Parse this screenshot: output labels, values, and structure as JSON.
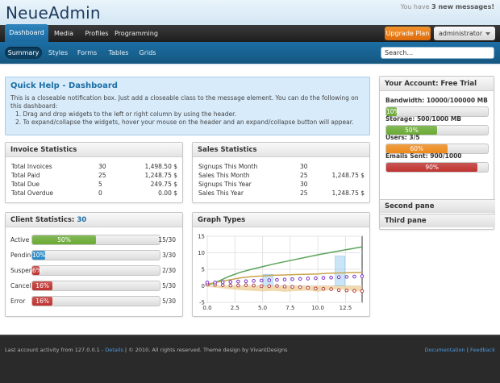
{
  "app": {
    "brand": "NeueAdmin",
    "messages_prefix": "You have",
    "messages_count": "3 new messages!"
  },
  "nav": {
    "tabs": [
      {
        "label": "Dashboard",
        "active": true
      },
      {
        "label": "Media",
        "active": false
      },
      {
        "label": "Profiles",
        "active": false
      },
      {
        "label": "Programming",
        "active": false
      }
    ],
    "upgrade_label": "Upgrade Plan",
    "user_label": "administrator"
  },
  "subnav": {
    "tabs": [
      {
        "label": "Summary",
        "active": true
      },
      {
        "label": "Styles",
        "active": false
      },
      {
        "label": "Forms",
        "active": false
      },
      {
        "label": "Tables",
        "active": false
      },
      {
        "label": "Grids",
        "active": false
      }
    ],
    "search_placeholder": "Search..."
  },
  "help": {
    "title": "Quick Help - Dashboard",
    "intro": "This is a closeable notification box. Just add a closeable class to the message element. You can do the following on this dashboard:",
    "items": [
      "1.  Drag and drop widgets to the left or right column by using the header.",
      "2.  To expand/collapse the widgets, hover your mouse on the header and an expand/collapse button will appear."
    ]
  },
  "invoice": {
    "title": "Invoice Statistics",
    "rows": [
      {
        "label": "Total Invoices",
        "count": "30",
        "amount": "1,498.50 $"
      },
      {
        "label": "Total Paid",
        "count": "25",
        "amount": "1,248.75 $"
      },
      {
        "label": "Total Due",
        "count": "5",
        "amount": "249.75 $"
      },
      {
        "label": "Total Overdue",
        "count": "0",
        "amount": "0.00 $"
      }
    ]
  },
  "sales": {
    "title": "Sales Statistics",
    "rows": [
      {
        "label": "Signups This Month",
        "count": "30",
        "amount": ""
      },
      {
        "label": "Sales This Month",
        "count": "25",
        "amount": "1,248.75 $"
      },
      {
        "label": "Signups This Year",
        "count": "30",
        "amount": ""
      },
      {
        "label": "Sales This Year",
        "count": "25",
        "amount": "1,248.75 $"
      }
    ]
  },
  "client": {
    "title": "Client Statistics:",
    "total": "30",
    "rows": [
      {
        "label": "Active",
        "bar_text": "50%",
        "fraction": 0.5,
        "color": "#6aab33",
        "count": "15/30"
      },
      {
        "label": "Pending",
        "bar_text": "10%",
        "fraction": 0.1,
        "color": "#2287c8",
        "count": "3/30"
      },
      {
        "label": "Suspended",
        "bar_text": "6%",
        "fraction": 0.06,
        "color": "#c0322f",
        "count": "2/30"
      },
      {
        "label": "Cancelled",
        "bar_text": "16%",
        "fraction": 0.16,
        "color": "#c0322f",
        "count": "5/30"
      },
      {
        "label": "Error",
        "bar_text": "16%",
        "fraction": 0.16,
        "color": "#c0322f",
        "count": "5/30"
      }
    ]
  },
  "graph": {
    "title": "Graph Types"
  },
  "chart_data": {
    "type": "line",
    "x_ticks": [
      "0.0",
      "2.5",
      "5.0",
      "7.5",
      "10.0",
      "12.5"
    ],
    "y_ticks": [
      "15",
      "10",
      "5",
      "0",
      "-5"
    ],
    "xlim": [
      0,
      14
    ],
    "ylim": [
      -5,
      15
    ],
    "grid": true,
    "series": [
      {
        "kind": "line",
        "color": "#5aa35a",
        "x": [
          0,
          1,
          2,
          3,
          4,
          5,
          6,
          7,
          8,
          9,
          10,
          11,
          12,
          13,
          14
        ],
        "y": [
          0.1,
          1.4,
          2.9,
          4.1,
          5.0,
          5.8,
          6.6,
          7.3,
          8.0,
          8.7,
          9.4,
          10.0,
          10.6,
          11.2,
          11.8
        ]
      },
      {
        "kind": "line",
        "color": "#c9a34a",
        "x": [
          0,
          1,
          2,
          3,
          4,
          5,
          6,
          7,
          8,
          9,
          10,
          11,
          12,
          13,
          14
        ],
        "y": [
          0.5,
          1.2,
          1.8,
          2.4,
          2.8,
          3.0,
          3.2,
          3.3,
          3.4,
          3.5,
          3.6,
          3.8,
          3.9,
          4.0,
          4.1
        ]
      },
      {
        "kind": "area",
        "color": "#e8c27a",
        "x": [
          0,
          1,
          2,
          3,
          4,
          5,
          6,
          7,
          8,
          9,
          10,
          11,
          12,
          13,
          14
        ],
        "y": [
          -0.3,
          -0.6,
          -1.0,
          -1.3,
          -1.5,
          -1.7,
          -1.5,
          -1.8,
          -1.6,
          -1.4,
          -1.8,
          -1.3,
          -1.0,
          -1.5,
          -1.7
        ]
      },
      {
        "kind": "points",
        "color": "#b23b3b",
        "x": [
          0,
          0.7,
          1.4,
          2.1,
          2.8,
          3.5,
          4.2,
          4.9,
          5.6,
          6.3,
          7.0,
          7.7,
          8.4,
          9.1,
          9.8,
          10.5,
          11.2,
          11.9,
          12.6,
          13.3,
          14.0
        ],
        "y": [
          0.4,
          0.3,
          0.2,
          0.1,
          0.1,
          0.2,
          0.1,
          -0.1,
          -0.1,
          0.0,
          -0.2,
          -0.3,
          -0.4,
          -0.6,
          -0.8,
          -0.9,
          -1.0,
          -1.3,
          -1.4,
          -1.5,
          -1.6
        ]
      },
      {
        "kind": "points",
        "color": "#7a33c9",
        "x": [
          0,
          0.7,
          1.4,
          2.1,
          2.8,
          3.5,
          4.2,
          4.9,
          5.6,
          6.3,
          7.0,
          7.7,
          8.4,
          9.1,
          9.8,
          10.5,
          11.2,
          11.9,
          12.6,
          13.3,
          14.0
        ],
        "y": [
          1.0,
          1.0,
          1.1,
          1.2,
          1.3,
          1.4,
          1.5,
          1.6,
          1.7,
          1.8,
          1.9,
          2.0,
          2.1,
          2.2,
          2.3,
          2.4,
          2.5,
          2.6,
          2.7,
          2.8,
          2.9
        ]
      },
      {
        "kind": "bars",
        "color": "#9fd0ef",
        "x": [
          5.5,
          12.0
        ],
        "y": [
          3.5,
          9.0
        ]
      }
    ]
  },
  "account": {
    "title": "Your Account: Free Trial",
    "rows": [
      {
        "label": "Bandwidth: 10000/100000 MB",
        "bar_text": "10%",
        "fraction": 0.1,
        "color": "#6aab33"
      },
      {
        "label": "Storage: 500/1000 MB",
        "bar_text": "50%",
        "fraction": 0.5,
        "color": "#6aab33"
      },
      {
        "label": "Users: 3/5",
        "bar_text": "60%",
        "fraction": 0.6,
        "color": "#ef8a1c"
      },
      {
        "label": "Emails Sent: 900/1000",
        "bar_text": "90%",
        "fraction": 0.9,
        "color": "#c0322f"
      }
    ],
    "panes": [
      "Second pane",
      "Third pane"
    ]
  },
  "footer": {
    "left_prefix": "Last account activity from 127.0.0.1 -",
    "details_link": "Details",
    "left_suffix": "| © 2010. All rights reserved. Theme design by VivantDesigns",
    "doc_link": "Documentation",
    "sep": "|",
    "feedback_link": "Feedback"
  }
}
